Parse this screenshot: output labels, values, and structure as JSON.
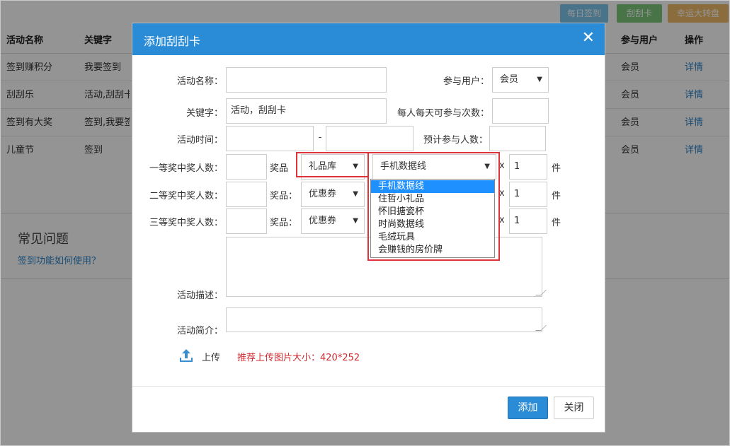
{
  "top_buttons": [
    {
      "label": "每日签到",
      "color": "#7cc6ea"
    },
    {
      "label": "刮刮卡",
      "color": "#7cc97a"
    },
    {
      "label": "幸运大转盘",
      "color": "#f0bc6a"
    }
  ],
  "table": {
    "headers": [
      "活动名称",
      "关键字",
      "参与用户",
      "操作"
    ],
    "rows": [
      {
        "name": "签到赚积分",
        "keyword": "我要签到",
        "users": "会员",
        "action": "详情"
      },
      {
        "name": "刮刮乐",
        "keyword": "活动,刮刮卡",
        "users": "会员",
        "action": "详情"
      },
      {
        "name": "签到有大奖",
        "keyword": "签到,我要签到",
        "users": "会员",
        "action": "详情"
      },
      {
        "name": "儿童节",
        "keyword": "签到",
        "users": "会员",
        "action": "详情"
      }
    ]
  },
  "faq": {
    "title": "常见问题",
    "link": "签到功能如何使用？"
  },
  "modal": {
    "title": "添加刮刮卡",
    "close": "✕",
    "form": {
      "activity_name_label": "活动名称：",
      "activity_name_value": "",
      "participants_label": "参与用户：",
      "participants_value": "会员",
      "keyword_label": "关键字：",
      "keyword_value": "活动，刮刮卡",
      "daily_times_label": "每人每天可参与次数：",
      "daily_times_value": "",
      "time_label": "活动时间：",
      "time_start": "",
      "time_sep": "-",
      "time_end": "",
      "expected_label": "预计参与人数：",
      "expected_value": "",
      "prize_label": "奖品：",
      "prize_label_short": "奖品",
      "times_sign": "x",
      "unit": "件",
      "tiers": [
        {
          "label": "一等奖中奖人数：",
          "count": "",
          "source": "礼品库",
          "item": "手机数据线",
          "qty": "1"
        },
        {
          "label": "二等奖中奖人数：",
          "count": "",
          "source": "优惠券",
          "item": "",
          "qty": "1"
        },
        {
          "label": "三等奖中奖人数：",
          "count": "",
          "source": "优惠券",
          "item": "",
          "qty": "1"
        }
      ],
      "dropdown_options": [
        "手机数据线",
        "住哲小礼品",
        "怀旧搪瓷杯",
        "时尚数据线",
        "毛绒玩具",
        "会赚钱的房价牌"
      ],
      "desc_label": "活动描述：",
      "intro_label": "活动简介：",
      "upload_label": "上传",
      "upload_hint": "推荐上传图片大小：420*252"
    },
    "buttons": {
      "add": "添加",
      "close": "关闭"
    }
  },
  "colors": {
    "header": "#2a8bd6",
    "highlight": "#e0323a",
    "link": "#2a84c8",
    "hint": "#d0282f"
  }
}
